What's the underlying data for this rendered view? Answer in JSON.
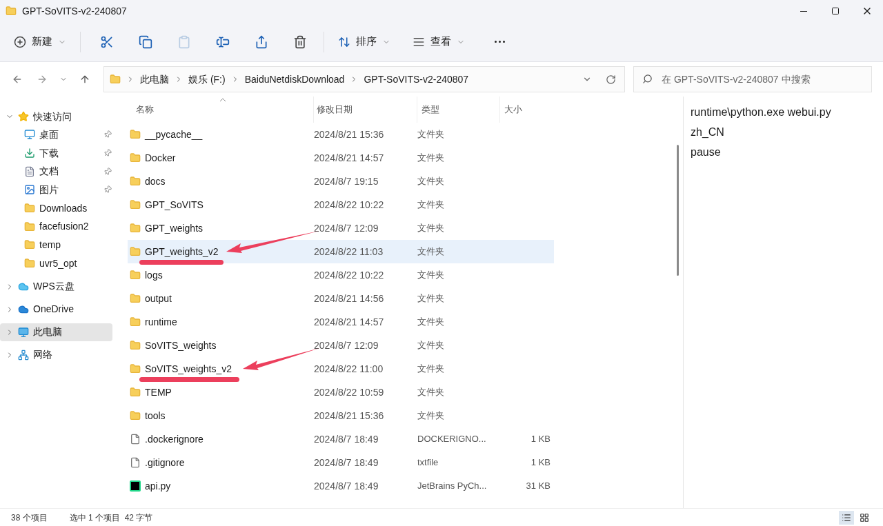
{
  "window": {
    "title": "GPT-SoVITS-v2-240807"
  },
  "toolbar": {
    "new_label": "新建",
    "sort_label": "排序",
    "view_label": "查看"
  },
  "address": {
    "crumbs": [
      "此电脑",
      "娱乐 (F:)",
      "BaiduNetdiskDownload",
      "GPT-SoVITS-v2-240807"
    ]
  },
  "search": {
    "placeholder": "在 GPT-SoVITS-v2-240807 中搜索"
  },
  "sidebar": {
    "items": [
      {
        "label": "快速访问",
        "kind": "star",
        "expanded": true,
        "selected": false,
        "children": [
          {
            "label": "桌面",
            "kind": "desktop",
            "pinned": true,
            "selected": false
          },
          {
            "label": "下载",
            "kind": "download",
            "pinned": true,
            "selected": false
          },
          {
            "label": "文档",
            "kind": "document",
            "pinned": true,
            "selected": false
          },
          {
            "label": "图片",
            "kind": "image",
            "pinned": true,
            "selected": false
          },
          {
            "label": "Downloads",
            "kind": "folder",
            "pinned": false,
            "selected": false
          },
          {
            "label": "facefusion2",
            "kind": "folder",
            "pinned": false,
            "selected": false
          },
          {
            "label": "temp",
            "kind": "folder",
            "pinned": false,
            "selected": false
          },
          {
            "label": "uvr5_opt",
            "kind": "folder",
            "pinned": false,
            "selected": false
          }
        ]
      },
      {
        "label": "WPS云盘",
        "kind": "cloud",
        "expanded": false,
        "selected": false
      },
      {
        "label": "OneDrive",
        "kind": "onedrive",
        "expanded": false,
        "selected": false
      },
      {
        "label": "此电脑",
        "kind": "pc",
        "expanded": false,
        "selected": true
      },
      {
        "label": "网络",
        "kind": "network",
        "expanded": false,
        "selected": false
      }
    ]
  },
  "table": {
    "columns": [
      "名称",
      "修改日期",
      "类型",
      "大小"
    ],
    "rows": [
      {
        "name": "__pycache__",
        "date": "2024/8/21 15:36",
        "type": "文件夹",
        "kind": "folder",
        "selected": false,
        "marked": false
      },
      {
        "name": "Docker",
        "date": "2024/8/21 14:57",
        "type": "文件夹",
        "kind": "folder",
        "selected": false,
        "marked": false
      },
      {
        "name": "docs",
        "date": "2024/8/7 19:15",
        "type": "文件夹",
        "kind": "folder",
        "selected": false,
        "marked": false
      },
      {
        "name": "GPT_SoVITS",
        "date": "2024/8/22 10:22",
        "type": "文件夹",
        "kind": "folder",
        "selected": false,
        "marked": false
      },
      {
        "name": "GPT_weights",
        "date": "2024/8/7 12:09",
        "type": "文件夹",
        "kind": "folder",
        "selected": false,
        "marked": false
      },
      {
        "name": "GPT_weights_v2",
        "date": "2024/8/22 11:03",
        "type": "文件夹",
        "kind": "folder",
        "selected": true,
        "marked": true
      },
      {
        "name": "logs",
        "date": "2024/8/22 10:22",
        "type": "文件夹",
        "kind": "folder",
        "selected": false,
        "marked": false
      },
      {
        "name": "output",
        "date": "2024/8/21 14:56",
        "type": "文件夹",
        "kind": "folder",
        "selected": false,
        "marked": false
      },
      {
        "name": "runtime",
        "date": "2024/8/21 14:57",
        "type": "文件夹",
        "kind": "folder",
        "selected": false,
        "marked": false
      },
      {
        "name": "SoVITS_weights",
        "date": "2024/8/7 12:09",
        "type": "文件夹",
        "kind": "folder",
        "selected": false,
        "marked": false
      },
      {
        "name": "SoVITS_weights_v2",
        "date": "2024/8/22 11:00",
        "type": "文件夹",
        "kind": "folder",
        "selected": false,
        "marked": true
      },
      {
        "name": "TEMP",
        "date": "2024/8/22 10:59",
        "type": "文件夹",
        "kind": "folder",
        "selected": false,
        "marked": false
      },
      {
        "name": "tools",
        "date": "2024/8/21 15:36",
        "type": "文件夹",
        "kind": "folder",
        "selected": false,
        "marked": false
      },
      {
        "name": ".dockerignore",
        "date": "2024/8/7 18:49",
        "type": "DOCKERIGNO...",
        "size": "1 KB",
        "kind": "file",
        "selected": false,
        "marked": false
      },
      {
        "name": ".gitignore",
        "date": "2024/8/7 18:49",
        "type": "txtfile",
        "size": "1 KB",
        "kind": "file",
        "selected": false,
        "marked": false
      },
      {
        "name": "api.py",
        "date": "2024/8/7 18:49",
        "type": "JetBrains PyCh...",
        "size": "31 KB",
        "kind": "python",
        "selected": false,
        "marked": false
      }
    ]
  },
  "preview": {
    "lines": [
      "runtime\\python.exe webui.py",
      "zh_CN",
      "pause"
    ]
  },
  "status_bar": {
    "count": "38 个项目",
    "selection": "选中 1 个项目  42 字节"
  }
}
